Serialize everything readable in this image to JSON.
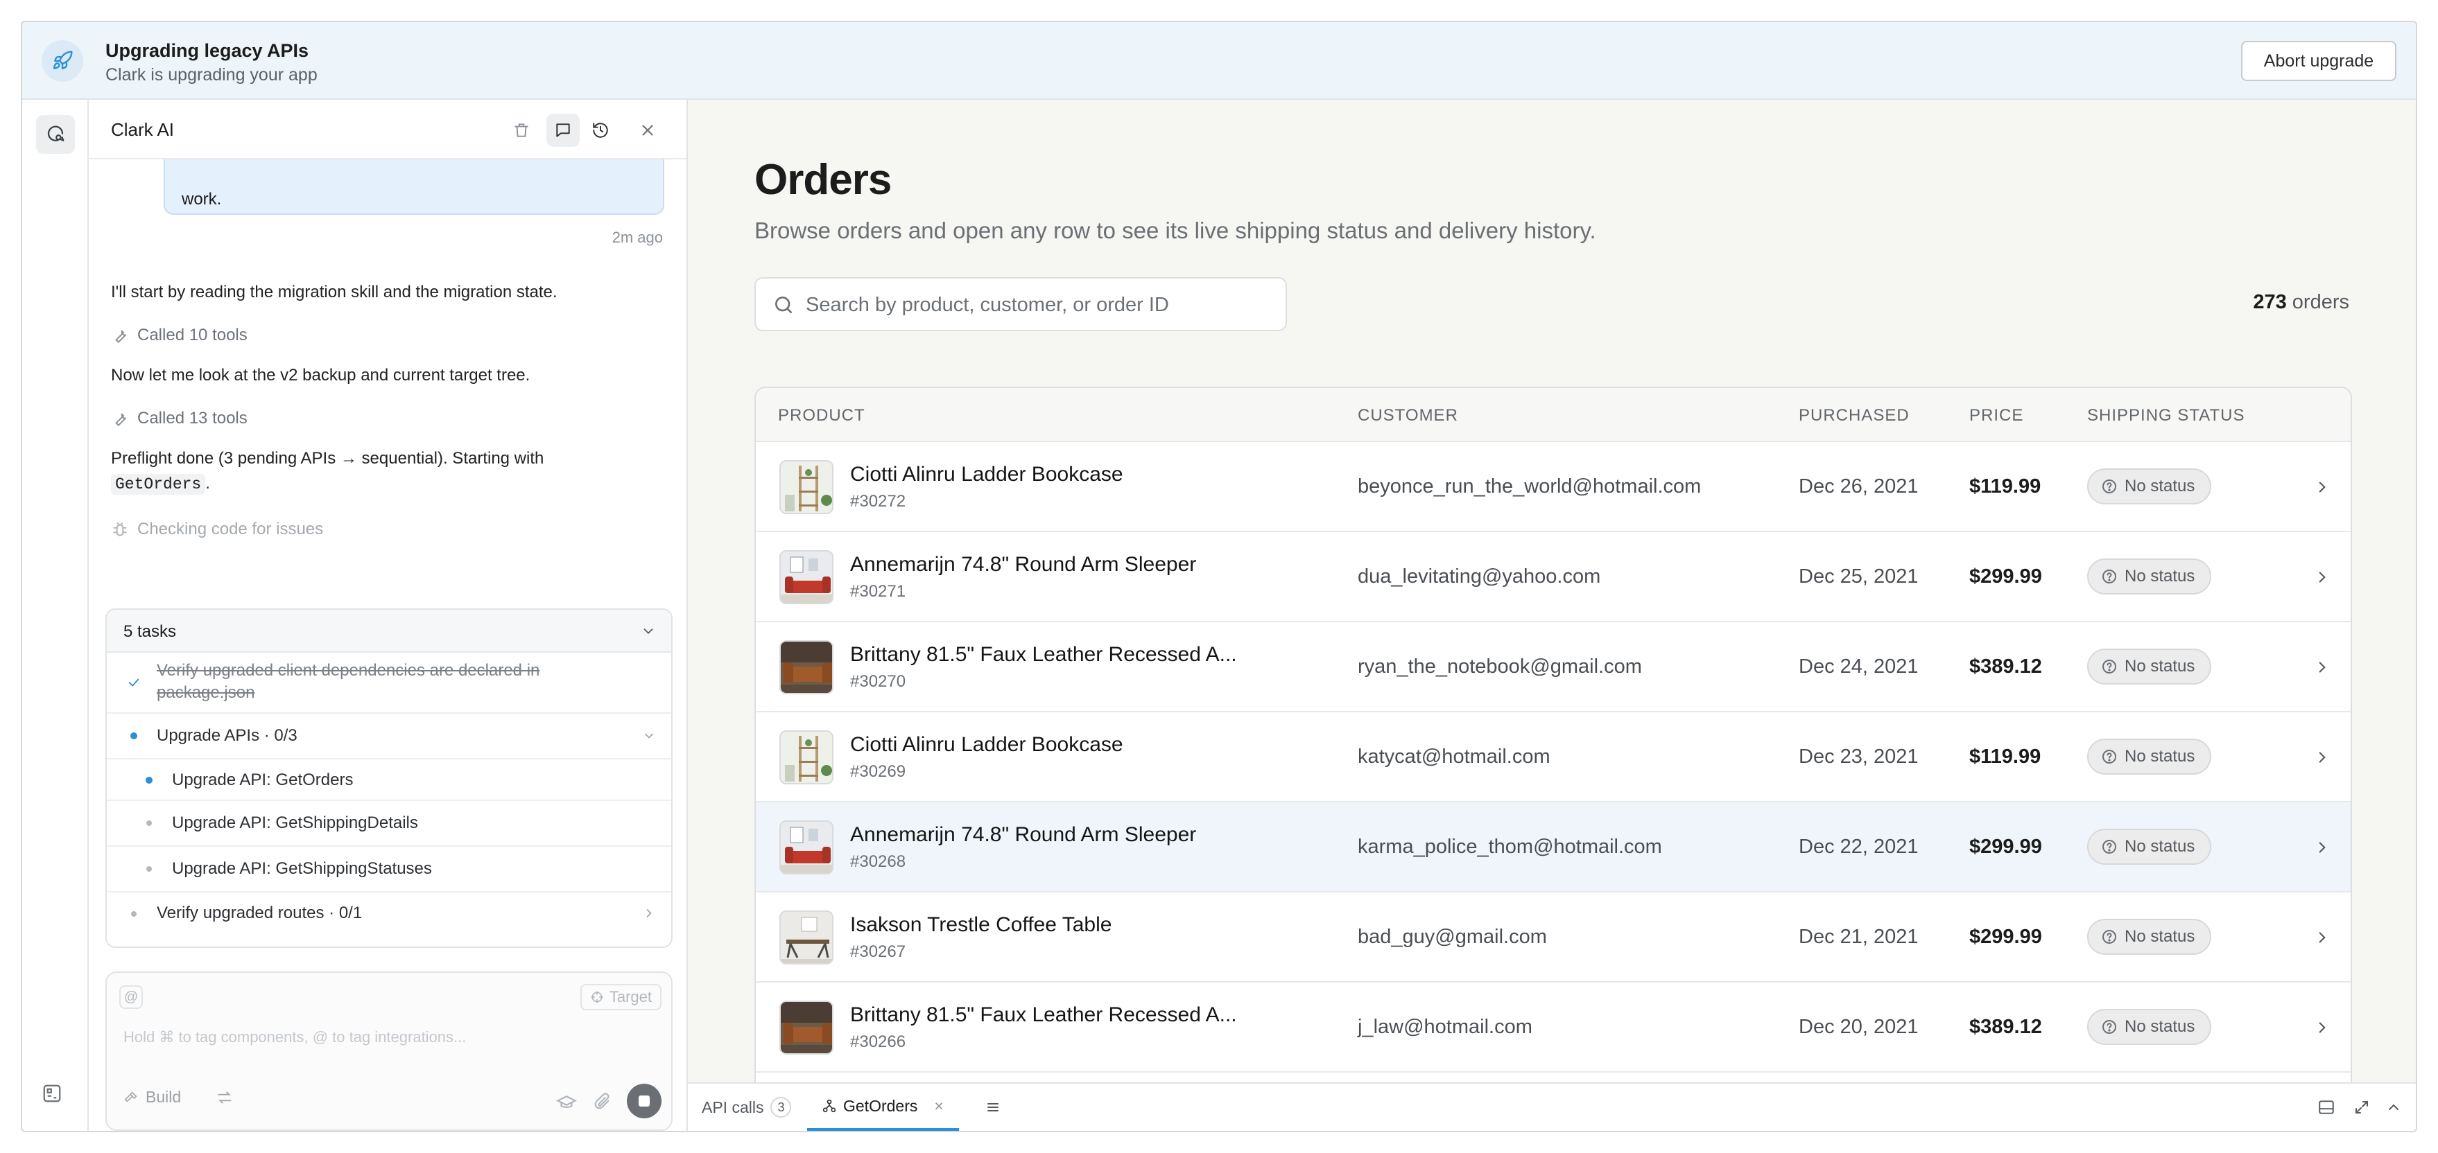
{
  "banner": {
    "title": "Upgrading legacy APIs",
    "subtitle": "Clark is upgrading your app",
    "abort_label": "Abort upgrade"
  },
  "sidebar": {
    "title": "Clark AI",
    "bubble_text": "work.",
    "timestamp": "2m ago",
    "messages": [
      "I'll start by reading the migration skill and the migration state.",
      "Now let me look at the v2 backup and current target tree.",
      "Preflight done (3 pending APIs → sequential). Starting with"
    ],
    "code_ref": "GetOrders",
    "code_suffix": ".",
    "tool_calls": [
      "Called 10 tools",
      "Called 13 tools"
    ],
    "checking": "Checking code for issues",
    "tasks": {
      "header": "5 tasks",
      "items": [
        {
          "label": "Verify upgraded client dependencies are declared in package.json",
          "state": "done"
        },
        {
          "label": "Upgrade APIs · 0/3",
          "state": "active"
        },
        {
          "label": "Upgrade API: GetOrders",
          "state": "active"
        },
        {
          "label": "Upgrade API: GetShippingDetails",
          "state": "pending"
        },
        {
          "label": "Upgrade API: GetShippingStatuses",
          "state": "pending"
        },
        {
          "label": "Verify upgraded routes · 0/1",
          "state": "pending"
        }
      ]
    },
    "composer": {
      "at": "@",
      "target": "Target",
      "placeholder": "Hold ⌘ to tag components, @ to tag integrations...",
      "build": "Build"
    }
  },
  "main": {
    "title": "Orders",
    "subtitle": "Browse orders and open any row to see its live shipping status and delivery history.",
    "search_placeholder": "Search by product, customer, or order ID",
    "count_number": "273",
    "count_label": "orders",
    "columns": [
      "PRODUCT",
      "CUSTOMER",
      "PURCHASED",
      "PRICE",
      "SHIPPING STATUS"
    ],
    "rows": [
      {
        "product": "Ciotti Alinru Ladder Bookcase",
        "id": "#30272",
        "customer": "beyonce_run_the_world@hotmail.com",
        "date": "Dec 26, 2021",
        "price": "$119.99",
        "status": "No status",
        "thumb": "bookcase"
      },
      {
        "product": "Annemarijn 74.8\" Round Arm Sleeper",
        "id": "#30271",
        "customer": "dua_levitating@yahoo.com",
        "date": "Dec 25, 2021",
        "price": "$299.99",
        "status": "No status",
        "thumb": "sofa"
      },
      {
        "product": "Brittany 81.5\" Faux Leather Recessed A...",
        "id": "#30270",
        "customer": "ryan_the_notebook@gmail.com",
        "date": "Dec 24, 2021",
        "price": "$389.12",
        "status": "No status",
        "thumb": "leather"
      },
      {
        "product": "Ciotti Alinru Ladder Bookcase",
        "id": "#30269",
        "customer": "katycat@hotmail.com",
        "date": "Dec 23, 2021",
        "price": "$119.99",
        "status": "No status",
        "thumb": "bookcase"
      },
      {
        "product": "Annemarijn 74.8\" Round Arm Sleeper",
        "id": "#30268",
        "customer": "karma_police_thom@hotmail.com",
        "date": "Dec 22, 2021",
        "price": "$299.99",
        "status": "No status",
        "thumb": "sofa"
      },
      {
        "product": "Isakson Trestle Coffee Table",
        "id": "#30267",
        "customer": "bad_guy@gmail.com",
        "date": "Dec 21, 2021",
        "price": "$299.99",
        "status": "No status",
        "thumb": "table"
      },
      {
        "product": "Brittany 81.5\" Faux Leather Recessed A...",
        "id": "#30266",
        "customer": "j_law@hotmail.com",
        "date": "Dec 20, 2021",
        "price": "$389.12",
        "status": "No status",
        "thumb": "leather"
      }
    ]
  },
  "bottom_tabs": {
    "api_calls": "API calls",
    "api_calls_count": "3",
    "get_orders": "GetOrders",
    "close": "×"
  },
  "colors": {
    "accent": "#2a8fd8",
    "banner_bg": "#edf5fb",
    "main_bg": "#f6f6f3",
    "highlight_row": "#eff5fb"
  }
}
